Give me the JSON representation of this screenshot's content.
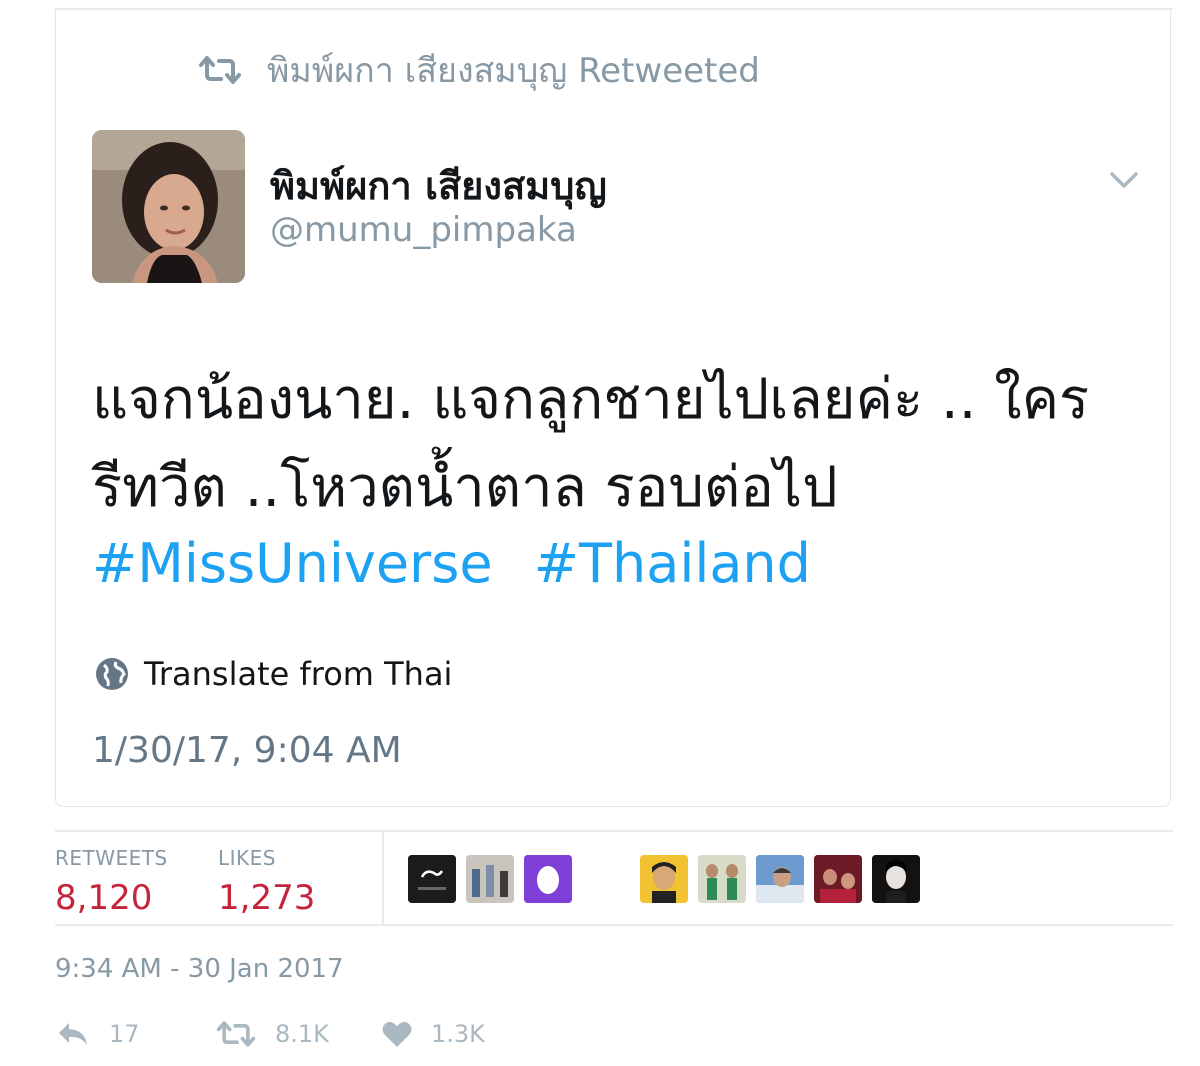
{
  "retweet_context": {
    "label": "พิมพ์ผกา เสียงสมบุญ Retweeted",
    "icon": "retweet-icon"
  },
  "author": {
    "name": "พิมพ์ผกา เสียงสมบุญ",
    "handle": "@mumu_pimpaka"
  },
  "tweet": {
    "lines": [
      "แจกน้องนาย. แจกลูกชายไปเลยค่ะ .. ใคร",
      "รีทวีต  ..โหวตน้ำตาล รอบต่อไป"
    ],
    "hashtags": [
      "#MissUniverse",
      "#Thailand"
    ],
    "translate_label": "Translate from Thai",
    "timestamp": "1/30/17, 9:04 AM"
  },
  "stats": {
    "retweets_label": "RETWEETS",
    "retweets_value": "8,120",
    "likes_label": "LIKES",
    "likes_value": "1,273"
  },
  "footer": {
    "timestamp": "9:34 AM - 30 Jan 2017"
  },
  "actions": {
    "reply_count": "17",
    "retweet_count": "8.1K",
    "like_count": "1.3K"
  },
  "colors": {
    "accent": "#1da1f2",
    "count_red": "#c4253c",
    "muted": "#8899a6"
  }
}
